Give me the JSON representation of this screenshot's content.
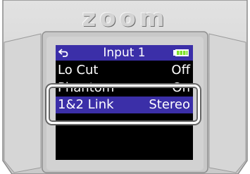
{
  "device": {
    "brand": "zoom"
  },
  "screen": {
    "title": "Input 1",
    "icons": {
      "back": "back-arrow-icon",
      "battery": "battery-icon"
    },
    "menu_items": [
      {
        "label": "Lo Cut",
        "value": "Off",
        "selected": false
      },
      {
        "label": "Phantom",
        "value": "On",
        "selected": false
      },
      {
        "label": "1&2 Link",
        "value": "Stereo",
        "selected": true
      }
    ]
  },
  "colors": {
    "selection": "#3b2fa8",
    "screen_background": "#000000",
    "text": "#ffffff",
    "battery": "#7ee02a",
    "device_body": "#cfcfcf"
  }
}
